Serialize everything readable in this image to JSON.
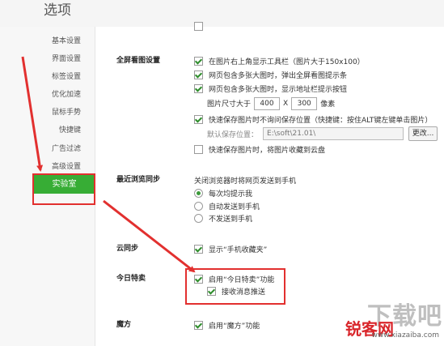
{
  "window": {
    "title": "选项"
  },
  "sidebar": {
    "items": [
      {
        "label": "基本设置"
      },
      {
        "label": "界面设置"
      },
      {
        "label": "标签设置"
      },
      {
        "label": "优化加速"
      },
      {
        "label": "鼠标手势"
      },
      {
        "label": "快捷键"
      },
      {
        "label": "广告过滤"
      },
      {
        "label": "高级设置"
      }
    ],
    "active_label": "实验室"
  },
  "fullscreen": {
    "title": "全屏看图设置",
    "opt1": "在图片右上角显示工具栏（图片大于150x100）",
    "opt2": "网页包含多张大图时，弹出全屏看图提示条",
    "opt3": "网页包含多张大图时，显示地址栏提示按钮",
    "size_label": "图片尺寸大于",
    "width": "400",
    "x_sep": "X",
    "height": "300",
    "unit": "像素",
    "quicksave": "快速保存图片时不询问保存位置（快捷键：按住ALT键左键单击图片）",
    "default_loc_label": "默认保存位置：",
    "path": "E:\\soft\\21.01\\",
    "change_btn": "更改...",
    "cloud": "快速保存图片时，将图片收藏到云盘"
  },
  "sync": {
    "title": "最近浏览同步",
    "desc": "关闭浏览器时将网页发送到手机",
    "r1": "每次均提示我",
    "r2": "自动发送到手机",
    "r3": "不发送到手机"
  },
  "cloud_sync": {
    "title": "云同步",
    "opt": "显示“手机收藏夹”"
  },
  "daily": {
    "title": "今日特卖",
    "enable": "启用“今日特卖”功能",
    "receive": "接收消息推送"
  },
  "magic": {
    "title": "魔方",
    "enable": "启用“魔方”功能"
  },
  "watermark": {
    "big": "下载吧",
    "red": "锐客网",
    "url": "www.xiazaiba.com"
  },
  "colors": {
    "accent": "#37ad35",
    "annotation": "#e2302f"
  }
}
